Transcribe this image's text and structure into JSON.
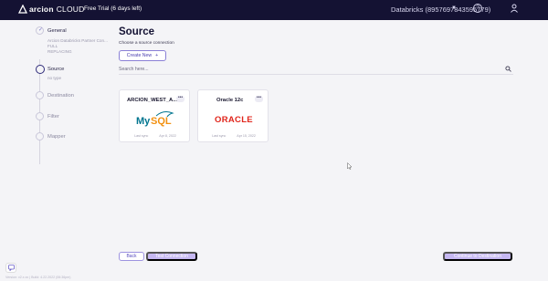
{
  "header": {
    "brand_name": "arcion",
    "brand_sub": "CLOUD",
    "trial_text": "Free Trial (6 days left)",
    "account": "Databricks (8957697843595779)",
    "icons": [
      "arcion-logo-icon",
      "chevron-down-icon",
      "help-icon",
      "user-icon"
    ]
  },
  "sidebar": {
    "steps": [
      {
        "title": "General",
        "sub_lines": [
          "Arcion Databricks Partner Con...",
          "FULL",
          "REPLACING"
        ],
        "state": "done"
      },
      {
        "title": "Source",
        "sub_lines": [
          "no type"
        ],
        "state": "active"
      },
      {
        "title": "Destination",
        "sub_lines": [],
        "state": "todo"
      },
      {
        "title": "Filter",
        "sub_lines": [],
        "state": "todo"
      },
      {
        "title": "Mapper",
        "sub_lines": [],
        "state": "todo"
      }
    ]
  },
  "main": {
    "title": "Source",
    "subtitle": "Choose a source connection",
    "create_new_label": "Create New",
    "search_placeholder": "Search here...",
    "cards": [
      {
        "name": "ARCION_WEST_A...",
        "logo": "mysql-logo",
        "last_sync_label": "Last sync",
        "last_sync_date": "Apr 8, 2022"
      },
      {
        "name": "Oracle 12c",
        "logo": "oracle-logo",
        "last_sync_label": "Last sync",
        "last_sync_date": "Apr 15, 2022"
      }
    ]
  },
  "footer": {
    "back_label": "Back",
    "test_label": "Test Connection",
    "continue_label": "Continue to Destination",
    "version": "Version: v2.x.xx | Build: 4.22.2022 (06:36pm)"
  },
  "colors": {
    "topbar": "#141233",
    "accent": "#4b3fb0",
    "button_disabled": "#c6b8f2",
    "mysql_blue": "#00758f",
    "mysql_orange": "#f29111",
    "oracle_red": "#e0251b"
  }
}
